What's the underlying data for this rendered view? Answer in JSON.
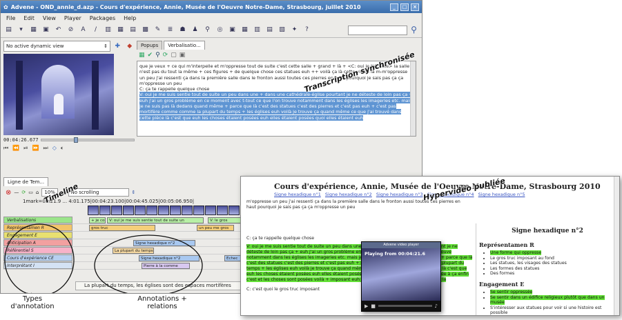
{
  "window": {
    "title": "Advene - OND_annie_d.azp - Cours d'expérience, Annie, Musée de l'Oeuvre Notre-Dame, Strasbourg, juillet 2010",
    "menu": [
      "File",
      "Edit",
      "View",
      "Player",
      "Packages",
      "Help"
    ]
  },
  "left_panel": {
    "dynamic_view": "No active dynamic view",
    "timecode": "00:04:26.677"
  },
  "transcript": {
    "tabs": [
      "Popups",
      "Verbalisatio..."
    ],
    "text_before": "que je veux + ce qui m'interpelle et m'oppresse tout de suite c'est cette salle + grand + là + <C: oui je t'écoute> la salle n'est pas du tout la même + ces figures + de quelque chose ces statues euh ++ voilà ça là cette vision là m-m'oppresse un peu j'ai ressenti ça dans la première salle dans le fronton aussi toutes ces pierres en haut pourquoi je sais pas ça ça m'oppresse un peu",
    "question": "C: ça te rappelle quelque chose",
    "highlighted": "V: oui je me suis sentie tout de suite un peu dans une + dans une cathédrale-église pourtant je ne déteste de loin pas ça + euh j'ai un gros problème en ce moment avec t-tout ce que l'on trouve notamment dans les églises les imageries etc. mais je ne suis pas là dedans quand même + parce que là c'est des statues c'est des pierres et c'est pas euh + c'est pas mortifère comme comme la plupart du temps + les églises euh voilà je trouve ça quand même ce que j'ai trouvé dans cette pièce là c'est que euh les choses étaient posées euh elles étaient posées quoi elles étaient euh"
  },
  "annotations_overlay": {
    "transcription": "Transcription synchronisée",
    "timeline": "Timeline",
    "hypervideo": "Hypervidéo publiée",
    "types": "Types d'annotation",
    "annotations": "Annotations + relations"
  },
  "timeline": {
    "tab": "Ligne de Tem...",
    "zoom": "10%",
    "scrolling": "No scrolling",
    "ruler": "1mark=0m21.9 ... 4:01.175|00:04:23.100|00:04:45.025|00:05:06.950|",
    "rows": [
      {
        "label": "Verbalisations",
        "bars": [
          "+ je con",
          "V: oui je me suis sentie tout de suite un",
          "V: le gros"
        ]
      },
      {
        "label": "Représentamen R",
        "bars": [
          "gros truc",
          "un peu me gros"
        ]
      },
      {
        "label": "Engagement E",
        "bars": []
      },
      {
        "label": "Anticipation A",
        "bars": [
          "Signe hexadique n°2"
        ]
      },
      {
        "label": "Référentiel S",
        "bars": [
          "La plupart du temps"
        ]
      },
      {
        "label": "Cours d'expérience CE",
        "bars": [
          "Signe hexadique n°2",
          "Echec"
        ]
      },
      {
        "label": "Interprétant I",
        "bars": [
          "Pierre à la comme"
        ]
      }
    ],
    "status": "La plupart du temps, les églises sont des espaces mortifères"
  },
  "web": {
    "title": "Cours d'expérience, Annie, Musée de l'Oeuvre Notre-Dame, Strasbourg 2010",
    "links": [
      "Signe hexadique n°1",
      "Signe hexadique n°2",
      "Signe hexadique n°3",
      "Signe hexadique n°4",
      "Signe hexadique n°5"
    ],
    "intro": "m'oppresse un peu j'ai ressenti ça dans la première salle dans le fronton aussi toutes ces pierres en haut pourquoi je sais pas ça ça m'oppresse un peu",
    "question": "C: ça te rappelle quelque chose",
    "green": "V: oui je me suis sentie tout de suite un peu dans une + dans une cathédrale-église pourtant je ne déteste de loin pas ça + euh j'ai un gros problème en ce moment avec t-tout ce que l'on trouve notamment dans les églises les imageries etc. mais je ne suis pas là dedans quand même + parce que là c'est des statues c'est des pierres et c'est pas euh + c'est pas mortifère comme comme la plupart du temps + les églises euh voilà je trouve ça quand même ce que j'ai trouvé dans cette pièce là c'est que euh les choses étaient posées euh elles étaient posées quoi elles étaient (n')est pas destinée à ça enfin c'est et les choses sont posées voilà + imposant euh voilà je suis sereine + encore j'ai non la",
    "footer": "C: c'est quoi le gros truc imposant",
    "right_title": "Signe hexadique n°2",
    "r_head": "Représentamen R",
    "r_items": [
      "Une forme qui oppresse",
      "Le gros truc imposant au fond",
      "Les statues, les visages des statues",
      "Les formes des statues",
      "Des formes"
    ],
    "e_head": "Engagement E",
    "e_items": [
      "Se sentir oppressée",
      "Se sentir dans un édifice religieux plutôt que dans un musée",
      "S'intéresser aux statues pour voir si une histoire est possible"
    ],
    "player_head": "Advene video player",
    "player_time": "Playing from 00:04:21.6"
  }
}
